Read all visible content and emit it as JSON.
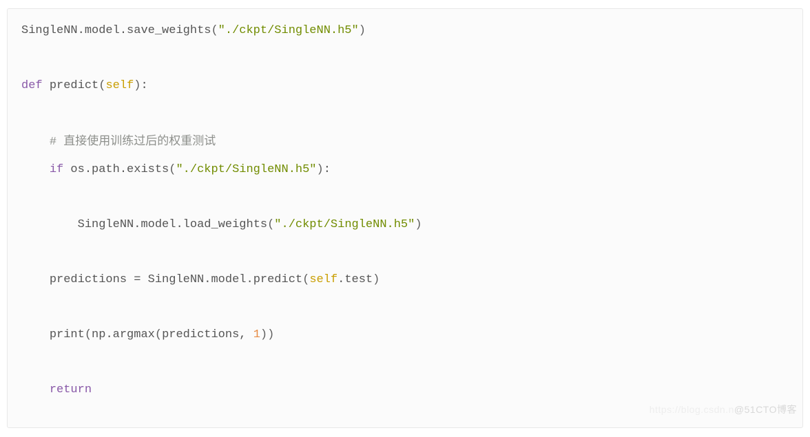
{
  "code": {
    "lines": [
      {
        "indent": 0,
        "tokens": [
          {
            "t": "SingleNN",
            "c": "nm"
          },
          {
            "t": ".",
            "c": "op"
          },
          {
            "t": "model",
            "c": "nm"
          },
          {
            "t": ".",
            "c": "op"
          },
          {
            "t": "save_weights",
            "c": "fn"
          },
          {
            "t": "(",
            "c": "br1"
          },
          {
            "t": "\"./ckpt/SingleNN.h5\"",
            "c": "str"
          },
          {
            "t": ")",
            "c": "br1"
          }
        ]
      },
      {
        "indent": 0,
        "blank": true
      },
      {
        "indent": 0,
        "tokens": [
          {
            "t": "def",
            "c": "kw"
          },
          {
            "t": " ",
            "c": "op"
          },
          {
            "t": "predict",
            "c": "fn"
          },
          {
            "t": "(",
            "c": "br1"
          },
          {
            "t": "self",
            "c": "slf"
          },
          {
            "t": ")",
            "c": "br1"
          },
          {
            "t": ":",
            "c": "op"
          }
        ]
      },
      {
        "indent": 0,
        "blank": true
      },
      {
        "indent": 1,
        "tokens": [
          {
            "t": "# ",
            "c": "cmt"
          },
          {
            "t": "直接使用训练过后的权重测试",
            "c": "cmt cjk"
          }
        ]
      },
      {
        "indent": 1,
        "tokens": [
          {
            "t": "if",
            "c": "kw"
          },
          {
            "t": " ",
            "c": "op"
          },
          {
            "t": "os",
            "c": "nm"
          },
          {
            "t": ".",
            "c": "op"
          },
          {
            "t": "path",
            "c": "nm"
          },
          {
            "t": ".",
            "c": "op"
          },
          {
            "t": "exists",
            "c": "fn"
          },
          {
            "t": "(",
            "c": "br1"
          },
          {
            "t": "\"./ckpt/SingleNN.h5\"",
            "c": "str"
          },
          {
            "t": ")",
            "c": "br1"
          },
          {
            "t": ":",
            "c": "op"
          }
        ]
      },
      {
        "indent": 0,
        "blank": true
      },
      {
        "indent": 2,
        "tokens": [
          {
            "t": "SingleNN",
            "c": "nm"
          },
          {
            "t": ".",
            "c": "op"
          },
          {
            "t": "model",
            "c": "nm"
          },
          {
            "t": ".",
            "c": "op"
          },
          {
            "t": "load_weights",
            "c": "fn"
          },
          {
            "t": "(",
            "c": "br1"
          },
          {
            "t": "\"./ckpt/SingleNN.h5\"",
            "c": "str"
          },
          {
            "t": ")",
            "c": "br1"
          }
        ]
      },
      {
        "indent": 0,
        "blank": true
      },
      {
        "indent": 1,
        "tokens": [
          {
            "t": "predictions",
            "c": "nm"
          },
          {
            "t": " ",
            "c": "op"
          },
          {
            "t": "=",
            "c": "op"
          },
          {
            "t": " ",
            "c": "op"
          },
          {
            "t": "SingleNN",
            "c": "nm"
          },
          {
            "t": ".",
            "c": "op"
          },
          {
            "t": "model",
            "c": "nm"
          },
          {
            "t": ".",
            "c": "op"
          },
          {
            "t": "predict",
            "c": "fn"
          },
          {
            "t": "(",
            "c": "br1"
          },
          {
            "t": "self",
            "c": "slf"
          },
          {
            "t": ".",
            "c": "op"
          },
          {
            "t": "test",
            "c": "nm"
          },
          {
            "t": ")",
            "c": "br1"
          }
        ]
      },
      {
        "indent": 0,
        "blank": true
      },
      {
        "indent": 1,
        "tokens": [
          {
            "t": "print",
            "c": "fn"
          },
          {
            "t": "(",
            "c": "br1"
          },
          {
            "t": "np",
            "c": "nm"
          },
          {
            "t": ".",
            "c": "op"
          },
          {
            "t": "argmax",
            "c": "fn"
          },
          {
            "t": "(",
            "c": "br2"
          },
          {
            "t": "predictions",
            "c": "nm"
          },
          {
            "t": ",",
            "c": "op"
          },
          {
            "t": " ",
            "c": "op"
          },
          {
            "t": "1",
            "c": "num"
          },
          {
            "t": ")",
            "c": "br2"
          },
          {
            "t": ")",
            "c": "br1"
          }
        ]
      },
      {
        "indent": 0,
        "blank": true
      },
      {
        "indent": 1,
        "tokens": [
          {
            "t": "return",
            "c": "kw"
          }
        ]
      }
    ]
  },
  "watermark": {
    "faint": "https://blog.csdn.n",
    "main": "@51CTO博客"
  }
}
